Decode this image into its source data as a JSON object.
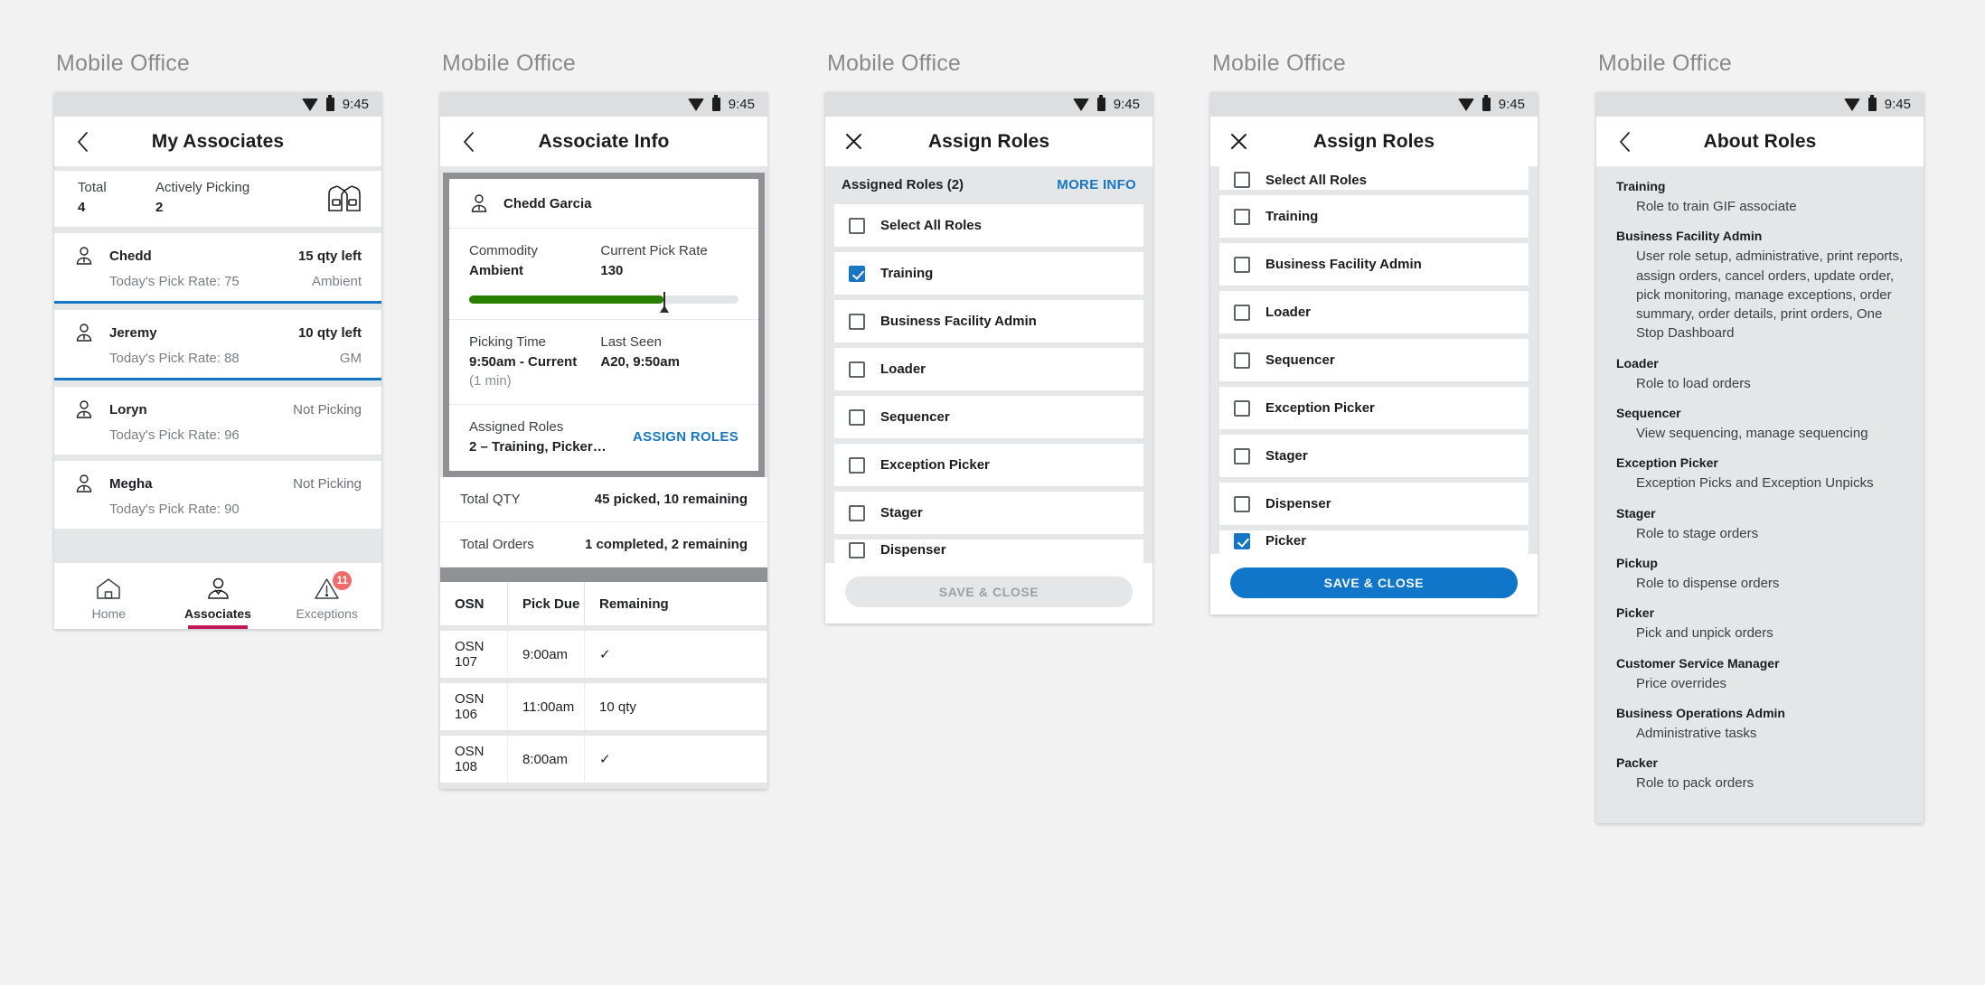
{
  "statusbar": {
    "time": "9:45"
  },
  "panels": {
    "associates": {
      "window_title": "Mobile Office",
      "bar_title": "My Associates",
      "back_icon": "chevron-left-icon",
      "summary": {
        "total_label": "Total",
        "total_value": "4",
        "active_label": "Actively Picking",
        "active_value": "2",
        "icon": "safety-vest-icon"
      },
      "rows": [
        {
          "name": "Chedd",
          "rate": "Today's Pick Rate: 75",
          "qty": "15 qty left",
          "commodity": "Ambient",
          "active": true
        },
        {
          "name": "Jeremy",
          "rate": "Today's Pick Rate: 88",
          "qty": "10 qty left",
          "commodity": "GM",
          "active": true
        },
        {
          "name": "Loryn",
          "rate": "Today's Pick Rate: 96",
          "qty": "Not Picking",
          "commodity": "",
          "active": false
        },
        {
          "name": "Megha",
          "rate": "Today's Pick Rate: 90",
          "qty": "Not Picking",
          "commodity": "",
          "active": false
        }
      ],
      "bottom_nav": [
        {
          "label": "Home",
          "icon": "home-icon",
          "selected": false,
          "badge": ""
        },
        {
          "label": "Associates",
          "icon": "person-icon",
          "selected": true,
          "badge": ""
        },
        {
          "label": "Exceptions",
          "icon": "warning-icon",
          "selected": false,
          "badge": "11"
        }
      ]
    },
    "associate_info": {
      "window_title": "Mobile Office",
      "bar_title": "Associate Info",
      "back_icon": "chevron-left-icon",
      "person_name": "Chedd Garcia",
      "commodity_label": "Commodity",
      "commodity_value": "Ambient",
      "pick_rate_label": "Current Pick Rate",
      "pick_rate_value": "130",
      "progress_percent": 72,
      "picking_time_label": "Picking Time",
      "picking_time_value": "9:50am - Current",
      "picking_time_sub": "(1 min)",
      "last_seen_label": "Last Seen",
      "last_seen_value": "A20, 9:50am",
      "assigned_roles_label": "Assigned Roles",
      "assigned_roles_value": "2 – Training, Picker…",
      "assign_roles_link": "ASSIGN ROLES",
      "total_qty_label": "Total QTY",
      "total_qty_value": "45 picked, 10 remaining",
      "total_orders_label": "Total Orders",
      "total_orders_value": "1 completed, 2 remaining",
      "table": {
        "headers": [
          "OSN",
          "Pick Due",
          "Remaining"
        ],
        "rows": [
          {
            "osn": "OSN 107",
            "due": "9:00am",
            "remaining": "✓"
          },
          {
            "osn": "OSN 106",
            "due": "11:00am",
            "remaining": "10 qty"
          },
          {
            "osn": "OSN 108",
            "due": "8:00am",
            "remaining": "✓"
          }
        ]
      }
    },
    "assign_roles": {
      "window_title": "Mobile Office",
      "bar_title": "Assign Roles",
      "close_icon": "close-icon",
      "subhead_label": "Assigned Roles (2)",
      "more_info_link": "MORE INFO",
      "items": [
        {
          "label": "Select All Roles",
          "checked": false
        },
        {
          "label": "Training",
          "checked": true
        },
        {
          "label": "Business Facility Admin",
          "checked": false
        },
        {
          "label": "Loader",
          "checked": false
        },
        {
          "label": "Sequencer",
          "checked": false
        },
        {
          "label": "Exception Picker",
          "checked": false
        },
        {
          "label": "Stager",
          "checked": false
        },
        {
          "label": "Dispenser",
          "checked": false
        }
      ],
      "save_label": "SAVE & CLOSE",
      "save_enabled": false
    },
    "assign_roles_scrolled": {
      "window_title": "Mobile Office",
      "bar_title": "Assign Roles",
      "close_icon": "close-icon",
      "items": [
        {
          "label": "Select All Roles",
          "checked": false
        },
        {
          "label": "Training",
          "checked": false
        },
        {
          "label": "Business Facility Admin",
          "checked": false
        },
        {
          "label": "Loader",
          "checked": false
        },
        {
          "label": "Sequencer",
          "checked": false
        },
        {
          "label": "Exception Picker",
          "checked": false
        },
        {
          "label": "Stager",
          "checked": false
        },
        {
          "label": "Dispenser",
          "checked": false
        },
        {
          "label": "Picker",
          "checked": true
        }
      ],
      "save_label": "SAVE & CLOSE",
      "save_enabled": true
    },
    "about_roles": {
      "window_title": "Mobile Office",
      "bar_title": "About Roles",
      "back_icon": "chevron-left-icon",
      "items": [
        {
          "title": "Training",
          "desc": "Role to train GIF associate"
        },
        {
          "title": "Business Facility Admin",
          "desc": "User role setup, administrative, print reports, assign orders, cancel orders, update order, pick monitoring, manage exceptions, order summary, order details, print orders, One Stop Dashboard"
        },
        {
          "title": "Loader",
          "desc": "Role to load orders"
        },
        {
          "title": "Sequencer",
          "desc": "View sequencing, manage sequencing"
        },
        {
          "title": "Exception Picker",
          "desc": "Exception Picks and Exception Unpicks"
        },
        {
          "title": "Stager",
          "desc": "Role to stage orders"
        },
        {
          "title": "Pickup",
          "desc": "Role to dispense orders"
        },
        {
          "title": "Picker",
          "desc": "Pick and unpick orders"
        },
        {
          "title": "Customer Service Manager",
          "desc": "Price overrides"
        },
        {
          "title": "Business Operations Admin",
          "desc": "Administrative tasks"
        },
        {
          "title": "Packer",
          "desc": "Role to pack orders"
        }
      ]
    }
  },
  "colors": {
    "accent_blue": "#1776c4",
    "progress_green": "#298000",
    "nav_selected": "#c2185b",
    "badge_red": "#f26b6b"
  }
}
